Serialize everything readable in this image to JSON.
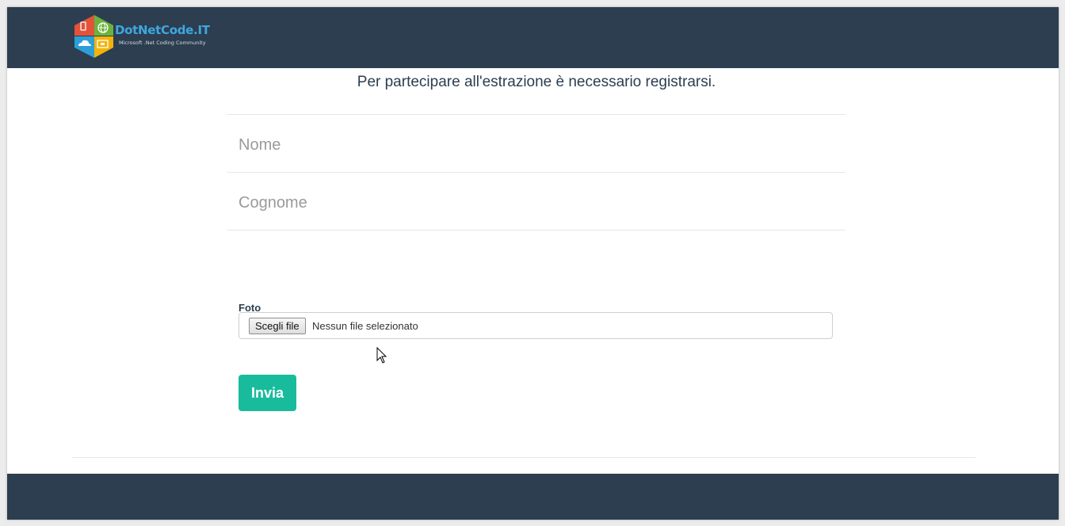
{
  "brand": {
    "title": "DotNetCode.IT",
    "subtitle": "Microsoft .Net Coding Community"
  },
  "form": {
    "intro": "Per partecipare all'estrazione è necessario registrarsi.",
    "nome_placeholder": "Nome",
    "cognome_placeholder": "Cognome",
    "foto_label": "Foto",
    "file_button_label": "Scegli file",
    "file_status": "Nessun file selezionato",
    "submit_label": "Invia"
  },
  "colors": {
    "navbar": "#2c3e50",
    "accent": "#18bc9c",
    "logo_text": "#3fa7e0"
  }
}
